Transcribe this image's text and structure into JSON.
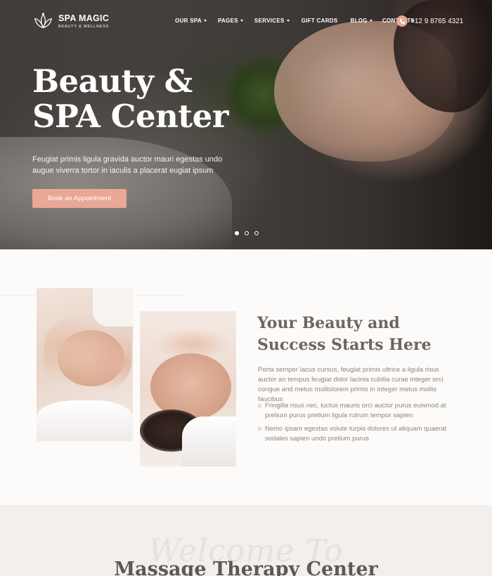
{
  "brand": {
    "name": "SPA MAGIC",
    "tagline": "BEAUTY & WELLNESS"
  },
  "nav": {
    "items": [
      {
        "label": "OUR SPA",
        "has_dropdown": true
      },
      {
        "label": "PAGES",
        "has_dropdown": true
      },
      {
        "label": "SERVICES",
        "has_dropdown": true
      },
      {
        "label": "GIFT CARDS",
        "has_dropdown": false
      },
      {
        "label": "BLOG",
        "has_dropdown": true
      },
      {
        "label": "CONTACTS",
        "has_dropdown": false
      }
    ],
    "phone": "+12 9 8765 4321"
  },
  "hero": {
    "title_line1": "Beauty &",
    "title_line2": "SPA Center",
    "subtitle": "Feugiat primis ligula gravida auctor mauri egestas undo augue viverra tortor in iaculis a placerat eugiat ipsum",
    "button_label": "Book an Appointment",
    "slides": 3,
    "active_slide": 1
  },
  "about": {
    "title_line1": "Your Beauty and",
    "title_line2": "Success Starts Here",
    "text": "Porta semper lacus cursus, feugiat primis ultrice a ligula risus auctor an tempus feugiat dolor lacinia cubilia curae integer orci congue and metus mollislorem primis in integer metus mollis faucibus",
    "list": [
      "Fringilla risus nec, luctus mauris orci auctor purus euismod at pretium purus pretium ligula rutrum tempor sapien",
      "Nemo ipsam egestas volute turpis dolores ut aliquam quaerat sodales sapien undo pretium purus"
    ]
  },
  "welcome": {
    "script": "Welcome To",
    "title": "Massage Therapy Center"
  },
  "colors": {
    "accent": "#e9a796",
    "heading": "#6d6561",
    "body_text": "#8b8581",
    "section_bg": "#f2efec"
  }
}
